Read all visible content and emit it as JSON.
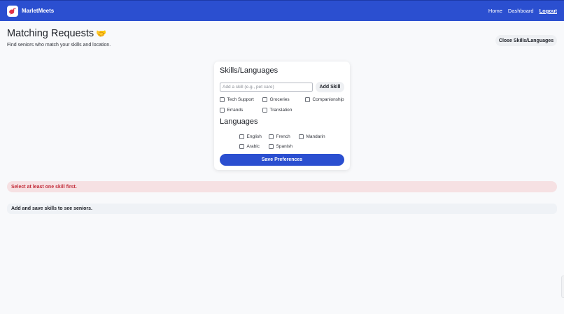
{
  "header": {
    "brand": "MarletMeets",
    "nav": {
      "home": "Home",
      "dashboard": "Dashboard",
      "logout": "Logout"
    },
    "colors": {
      "bar": "#2b4fd0",
      "logo_accent": "#e0344b"
    }
  },
  "page": {
    "title": "Matching Requests",
    "title_emoji": "🤝",
    "subtitle": "Find seniors who match your skills and location.",
    "close_button": "Close Skills/Languages"
  },
  "skills_panel": {
    "title": "Skills/Languages",
    "input_placeholder": "Add a skill (e.g., pet care)",
    "input_value": "",
    "add_button": "Add Skill",
    "skills": [
      {
        "label": "Tech Support",
        "checked": false
      },
      {
        "label": "Groceries",
        "checked": false
      },
      {
        "label": "Companionship",
        "checked": false
      },
      {
        "label": "Errands",
        "checked": false
      },
      {
        "label": "Translation",
        "checked": false
      }
    ],
    "languages_title": "Languages",
    "languages": [
      {
        "label": "English",
        "checked": false
      },
      {
        "label": "French",
        "checked": false
      },
      {
        "label": "Mandarin",
        "checked": false
      },
      {
        "label": "Arabic",
        "checked": false
      },
      {
        "label": "Spanish",
        "checked": false
      }
    ],
    "save_button": "Save Preferences"
  },
  "alert": {
    "text": "Select at least one skill first.",
    "color": "#c22d3a"
  },
  "info": {
    "text": "Add and save skills to see seniors."
  }
}
